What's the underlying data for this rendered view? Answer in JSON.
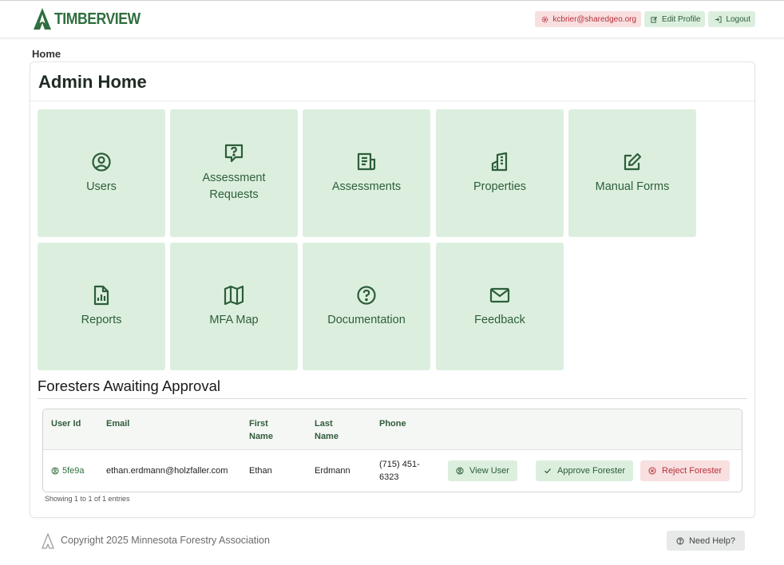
{
  "header": {
    "brand": "TIMBERVIEW",
    "user_email": "kcbrier@sharedgeo.org",
    "edit_profile_label": "Edit Profile",
    "logout_label": "Logout"
  },
  "breadcrumb": "Home",
  "page_title": "Admin Home",
  "tiles": [
    {
      "label": "Users",
      "icon": "user-circle-icon"
    },
    {
      "label": "Assessment Requests",
      "icon": "question-bubble-icon"
    },
    {
      "label": "Assessments",
      "icon": "news-icon"
    },
    {
      "label": "Properties",
      "icon": "building-icon"
    },
    {
      "label": "Manual Forms",
      "icon": "edit-icon"
    },
    {
      "label": "Reports",
      "icon": "report-icon"
    },
    {
      "label": "MFA Map",
      "icon": "map-icon"
    },
    {
      "label": "Documentation",
      "icon": "help-circle-icon"
    },
    {
      "label": "Feedback",
      "icon": "mail-icon"
    }
  ],
  "foresters": {
    "title": "Foresters Awaiting Approval",
    "columns": {
      "user_id": "User Id",
      "email": "Email",
      "first_name": "First Name",
      "last_name": "Last Name",
      "phone": "Phone"
    },
    "rows": [
      {
        "user_id": "5fe9a",
        "email": "ethan.erdmann@holzfaller.com",
        "first_name": "Ethan",
        "last_name": "Erdmann",
        "phone": "(715) 451-6323",
        "view_label": "View User",
        "approve_label": "Approve Forester",
        "reject_label": "Reject Forester"
      }
    ],
    "entries_text": "Showing 1 to 1 of 1 entries"
  },
  "footer": {
    "copyright": "Copyright 2025 Minnesota Forestry Association",
    "help_label": "Need Help?"
  },
  "colors": {
    "brand_green": "#2f6e3f",
    "tile_bg": "#dcefdf",
    "danger_bg": "#f8dfe0",
    "danger_text": "#b8313b"
  }
}
